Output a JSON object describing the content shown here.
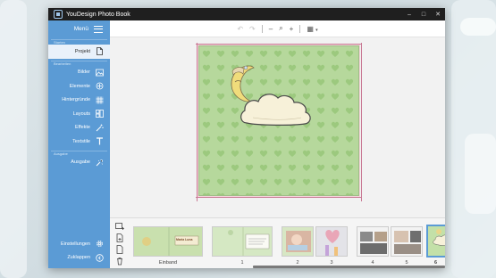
{
  "window": {
    "title": "YouDesign Photo Book"
  },
  "titlebar": {
    "minimize": "–",
    "maximize": "□",
    "close": "✕"
  },
  "sidebar": {
    "menu_label": "Menü",
    "section_start": "Starten",
    "section_edit": "Bearbeiten",
    "section_output": "Ausgabe",
    "items": [
      {
        "label": "Projekt",
        "icon": "document-icon",
        "active": true
      },
      {
        "label": "Bilder",
        "icon": "image-icon"
      },
      {
        "label": "Elemente",
        "icon": "shapes-icon"
      },
      {
        "label": "Hintergründe",
        "icon": "pattern-icon"
      },
      {
        "label": "Layouts",
        "icon": "layout-icon"
      },
      {
        "label": "Effekte",
        "icon": "sparkle-icon"
      },
      {
        "label": "Textstile",
        "icon": "text-icon"
      },
      {
        "label": "Ausgabe",
        "icon": "output-icon"
      }
    ],
    "settings_label": "Einstellungen",
    "collapse_label": "Zuklappen"
  },
  "toolbar": {
    "undo": "↶",
    "redo": "↷",
    "zoom_out": "–",
    "zoom": "⌕",
    "zoom_in": "+",
    "grid": "▦",
    "grid_caret": "▾"
  },
  "filmstrip": {
    "pages": [
      {
        "label": "Einband"
      },
      {
        "label": "1"
      },
      {
        "label": "2"
      },
      {
        "label": "3"
      },
      {
        "label": "4"
      },
      {
        "label": "5"
      },
      {
        "label": "6",
        "selected": true
      }
    ],
    "cover_text": "Maria Luna"
  },
  "colors": {
    "accent": "#5b9bd5",
    "page_bg": "#b4d69a",
    "titlebar": "#1f1f1f"
  }
}
